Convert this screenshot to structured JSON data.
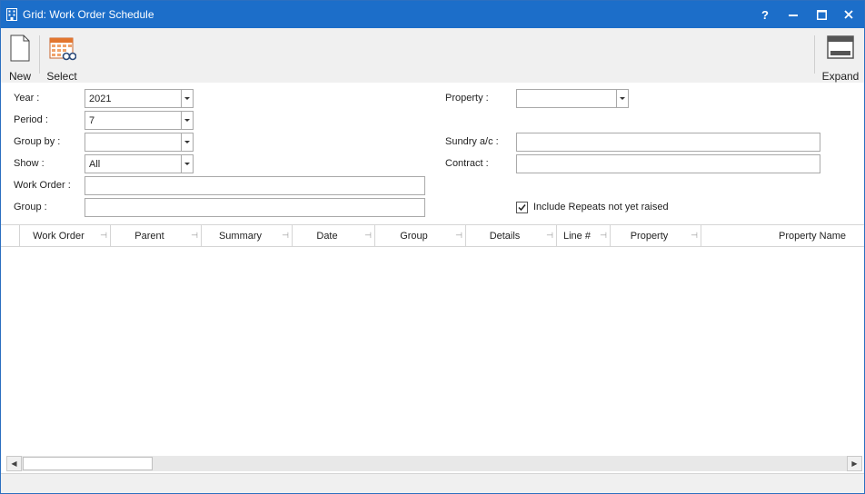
{
  "window": {
    "title": "Grid: Work Order Schedule",
    "help_label": "?",
    "accent_color": "#1c6ec9"
  },
  "toolbar": {
    "new_label": "New",
    "select_label": "Select",
    "expand_label": "Expand"
  },
  "form": {
    "year": {
      "label": "Year :",
      "value": "2021"
    },
    "period": {
      "label": "Period :",
      "value": "7"
    },
    "group_by": {
      "label": "Group by :",
      "value": ""
    },
    "show": {
      "label": "Show :",
      "value": "All"
    },
    "work_order": {
      "label": "Work Order :",
      "value": ""
    },
    "group": {
      "label": "Group :",
      "value": ""
    },
    "property": {
      "label": "Property :",
      "value": ""
    },
    "sundry": {
      "label": "Sundry a/c :",
      "value": ""
    },
    "contract": {
      "label": "Contract :",
      "value": ""
    },
    "include_repeats": {
      "label": "Include Repeats not yet raised",
      "checked": true
    }
  },
  "grid": {
    "columns": [
      "Work Order",
      "Parent",
      "Summary",
      "Date",
      "Group",
      "Details",
      "Line #",
      "Property",
      "Property Name"
    ],
    "rows": []
  }
}
